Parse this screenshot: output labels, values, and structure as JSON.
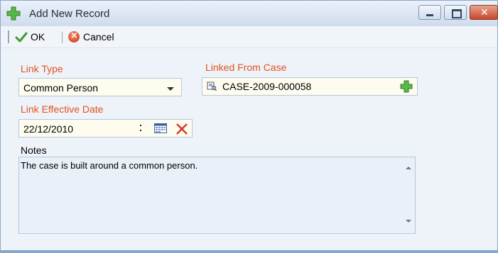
{
  "window": {
    "title": "Add New Record",
    "icon": "green-plus-icon",
    "controls": [
      "minimize-icon",
      "maximize-icon",
      "close-icon"
    ]
  },
  "toolbar": {
    "ok_label": "OK",
    "cancel_label": "Cancel",
    "ok_icon": "checkmark-icon",
    "cancel_icon": "cancel-circle-icon"
  },
  "form": {
    "link_type": {
      "label": "Link Type",
      "value": "Common Person"
    },
    "linked_from_case": {
      "label": "Linked From Case",
      "value": "CASE-2009-000058"
    },
    "link_effective_date": {
      "label": "Link Effective Date",
      "value": "22/12/2010"
    },
    "notes": {
      "label": "Notes",
      "value": "The case is built around a common person."
    }
  },
  "colors": {
    "label_accent": "#e0521f",
    "field_background": "#fdfcef",
    "window_background": "#eef3f9"
  }
}
